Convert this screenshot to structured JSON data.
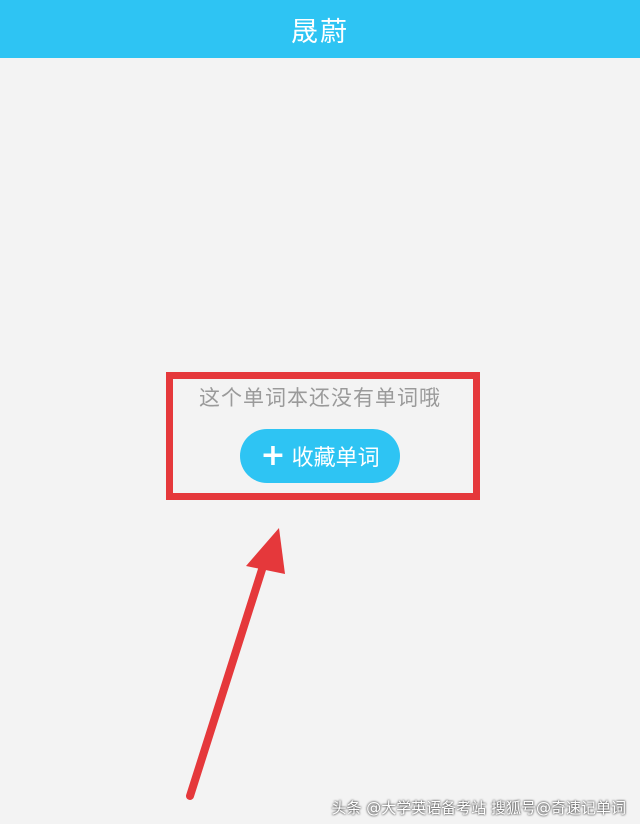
{
  "app_bar": {
    "title": "晟蔚"
  },
  "empty_state": {
    "message": "这个单词本还没有单词哦",
    "add_button_label": "收藏单词",
    "add_button_icon": "plus-icon"
  },
  "annotation": {
    "highlight_color": "#e5383b"
  },
  "watermark": {
    "text": "头条 @大学英语备考站 搜狐号@奇速记单词"
  },
  "colors": {
    "accent": "#2ec4f3",
    "background": "#f3f3f3",
    "annotation_red": "#e5383b"
  }
}
